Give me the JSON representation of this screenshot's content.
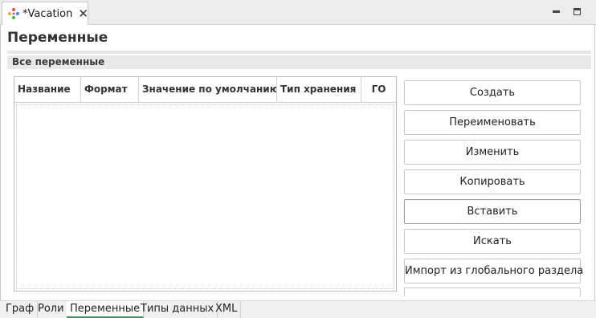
{
  "editor_tab": {
    "title": "*Vacation",
    "close_symbol": "✕",
    "icon": "process-icon"
  },
  "window_controls": {
    "minimize_icon": "minimize-icon",
    "maximize_icon": "maximize-icon"
  },
  "page": {
    "title": "Переменные"
  },
  "section": {
    "title": "Все переменные"
  },
  "table": {
    "columns": [
      "Название",
      "Формат",
      "Значение по умолчанию",
      "Тип хранения",
      "ГО"
    ],
    "rows": []
  },
  "buttons": {
    "create": "Создать",
    "rename": "Переименовать",
    "edit": "Изменить",
    "copy": "Копировать",
    "paste": "Вставить",
    "search": "Искать",
    "import_global": "Импорт из глобального раздела"
  },
  "bottom_tabs": [
    "Граф",
    "Роли",
    "Переменные",
    "Типы данных",
    "XML"
  ],
  "active_bottom_tab": "Переменные",
  "colors": {
    "active_tab_underline": "#3a9d4b",
    "background": "#ffffff",
    "tabbar": "#ececec"
  }
}
